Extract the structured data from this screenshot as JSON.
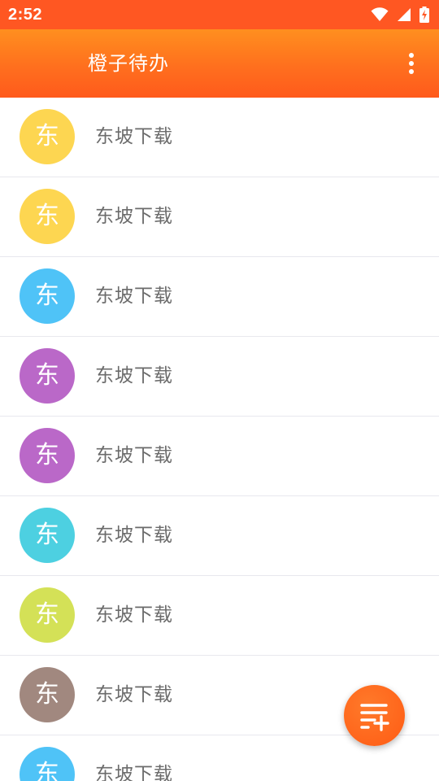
{
  "status_bar": {
    "time": "2:52",
    "icons": [
      "wifi-icon",
      "signal-icon",
      "battery-charging-icon"
    ]
  },
  "app_bar": {
    "title": "橙子待办",
    "menu_icon": "more-vertical-icon"
  },
  "list": {
    "items": [
      {
        "avatar_text": "东",
        "avatar_color": "#fdd651",
        "label": "东坡下载"
      },
      {
        "avatar_text": "东",
        "avatar_color": "#fdd651",
        "label": "东坡下载"
      },
      {
        "avatar_text": "东",
        "avatar_color": "#4fc3f7",
        "label": "东坡下载"
      },
      {
        "avatar_text": "东",
        "avatar_color": "#ba68c8",
        "label": "东坡下载"
      },
      {
        "avatar_text": "东",
        "avatar_color": "#ba68c8",
        "label": "东坡下载"
      },
      {
        "avatar_text": "东",
        "avatar_color": "#4dd0e1",
        "label": "东坡下载"
      },
      {
        "avatar_text": "东",
        "avatar_color": "#d4e157",
        "label": "东坡下载"
      },
      {
        "avatar_text": "东",
        "avatar_color": "#a1887f",
        "label": "东坡下载"
      },
      {
        "avatar_text": "东",
        "avatar_color": "#4fc3f7",
        "label": "东坡下载"
      }
    ]
  },
  "fab": {
    "icon": "add-list-icon",
    "color": "#ff5b14"
  },
  "colors": {
    "status_bar": "#ff5722",
    "app_bar_top": "#ff8f1f",
    "app_bar_bottom": "#ff5a1c",
    "item_text": "#6b6b6b",
    "divider": "#e8e8ee"
  }
}
